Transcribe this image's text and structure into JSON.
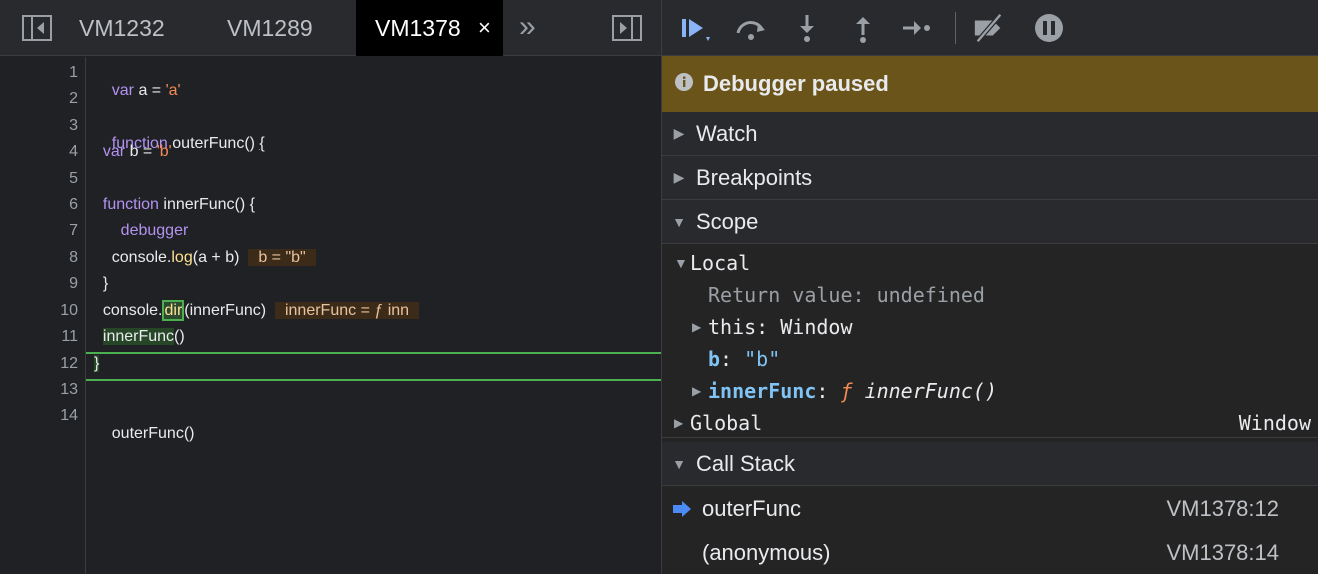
{
  "tabs": [
    {
      "label": "VM1232"
    },
    {
      "label": "VM1289"
    },
    {
      "label": "VM1378",
      "active": true
    }
  ],
  "tab_close_glyph": "×",
  "more_tabs_glyph": "»",
  "code": {
    "line_numbers": [
      "1",
      "2",
      "3",
      "4",
      "5",
      "6",
      "7",
      "8",
      "9",
      "10",
      "11",
      "12",
      "13",
      "14"
    ],
    "l1": {
      "kw": "var",
      "rest": " a = ",
      "str": "'a'"
    },
    "l3": {
      "kw": "function",
      "rest": " outerFunc() ",
      "brace": "{"
    },
    "l4": {
      "kw": "var",
      "rest": " b = ",
      "str": "'b'"
    },
    "l6": {
      "kw": "function",
      "rest": " innerFunc() {"
    },
    "l7": {
      "kw": "debugger"
    },
    "l8": {
      "pre": "console.",
      "method": "log",
      "args": "(a + b)",
      "inline": "b = \"b\""
    },
    "l9": {
      "text": "}"
    },
    "l10": {
      "pre": "console.",
      "method": "dir",
      "args": "(innerFunc)",
      "inline": "innerFunc = ƒ inn"
    },
    "l11": {
      "call": "innerFunc",
      "args": "()"
    },
    "l12": {
      "text": "}"
    },
    "l14": {
      "text": "outerFunc()"
    }
  },
  "banner": {
    "text": "Debugger paused"
  },
  "sections": {
    "watch": "Watch",
    "breakpoints": "Breakpoints",
    "scope": "Scope",
    "call_stack": "Call Stack"
  },
  "scope": {
    "local_label": "Local",
    "return_value": {
      "name": "Return value",
      "value": "undefined"
    },
    "this_row": {
      "name": "this",
      "value": "Window"
    },
    "b_row": {
      "name": "b",
      "value": "\"b\""
    },
    "inner_row": {
      "name": "innerFunc",
      "f": "ƒ",
      "value": "innerFunc()"
    },
    "global": {
      "label": "Global",
      "value": "Window"
    }
  },
  "call_stack": [
    {
      "name": "outerFunc",
      "location": "VM1378:12",
      "current": true
    },
    {
      "name": "(anonymous)",
      "location": "VM1378:14"
    }
  ],
  "colors": {
    "paused_banner": "#6b5419",
    "accent_blue": "#8ab4f8",
    "exec_line_green": "#4caf50"
  }
}
